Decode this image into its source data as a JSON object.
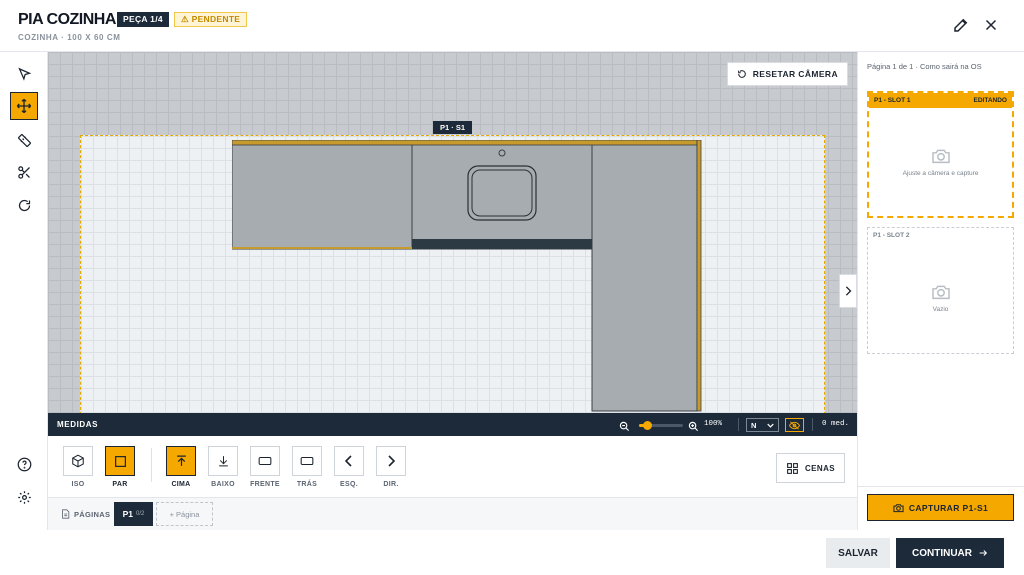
{
  "header": {
    "title": "PIA COZINHA",
    "piece_badge": "PEÇA 1/4",
    "status_badge": "PENDENTE",
    "subtitle": "COZINHA · 100 X 60 CM"
  },
  "toolbar": {
    "tools": [
      {
        "name": "select",
        "icon": "cursor-icon"
      },
      {
        "name": "move",
        "icon": "move-icon",
        "active": true
      },
      {
        "name": "measure",
        "icon": "ruler-icon"
      },
      {
        "name": "cut",
        "icon": "scissors-icon"
      },
      {
        "name": "rotate",
        "icon": "rotate-icon"
      }
    ],
    "bottom": [
      {
        "name": "help",
        "icon": "help-icon"
      },
      {
        "name": "settings",
        "icon": "gear-icon"
      }
    ]
  },
  "canvas": {
    "reset_label": "RESETAR CÂMERA",
    "piece_tag": "P1 · S1"
  },
  "medidas": {
    "label": "MEDIDAS",
    "zoom_value": "100%",
    "zoom_level": 0.18,
    "select_value": "N",
    "count": "0 med."
  },
  "views": {
    "buttons": [
      {
        "label": "ISO",
        "icon": "cube-icon"
      },
      {
        "label": "PAR",
        "icon": "square-icon",
        "active": true
      },
      {
        "label": "CIMA",
        "icon": "arrow-up-bar-icon",
        "active": true
      },
      {
        "label": "BAIXO",
        "icon": "arrow-down-bar-icon"
      },
      {
        "label": "FRENTE",
        "icon": "rectangle-icon"
      },
      {
        "label": "TRÁS",
        "icon": "rectangle-icon"
      },
      {
        "label": "ESQ.",
        "icon": "chevron-left-icon"
      },
      {
        "label": "DIR.",
        "icon": "chevron-right-icon"
      }
    ],
    "cenas_label": "CENAS"
  },
  "pages": {
    "label": "PÁGINAS",
    "current": "P1",
    "current_count": "0/2",
    "add_label": "+ Página"
  },
  "right_panel": {
    "header": "Página 1 de 1 · Como sairá na OS",
    "slot1": {
      "title": "P1 - SLOT 1",
      "state": "EDITANDO",
      "hint": "Ajuste a câmera e capture"
    },
    "slot2": {
      "title": "P1 - SLOT 2",
      "hint": "Vazio"
    },
    "capture_label": "CAPTURAR P1-S1"
  },
  "footer": {
    "save_label": "SALVAR",
    "continue_label": "CONTINUAR"
  },
  "colors": {
    "accent": "#f5a800",
    "dark": "#1c2a3a"
  }
}
